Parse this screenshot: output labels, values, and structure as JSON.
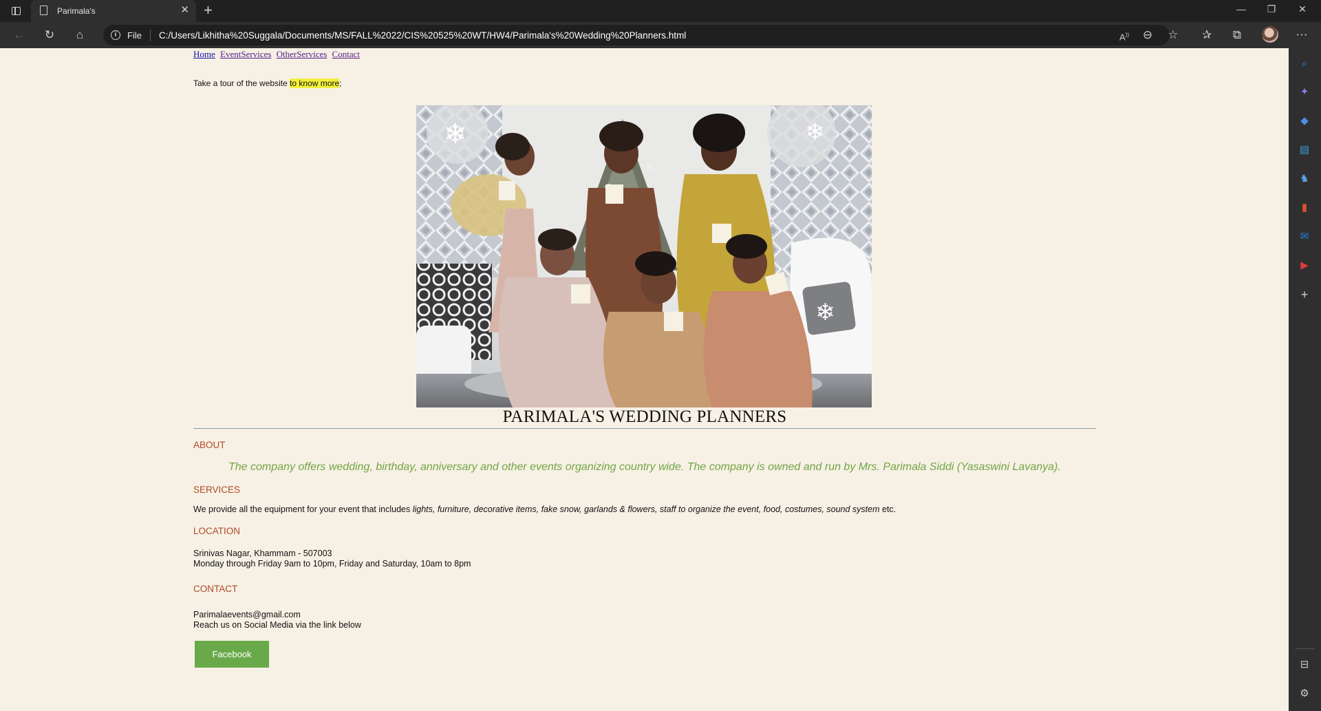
{
  "browser": {
    "tab_title": "Parimala's",
    "url_scheme": "File",
    "url": "C:/Users/Likhitha%20Suggala/Documents/MS/FALL%2022/CIS%20525%20WT/HW4/Parimala's%20Wedding%20Planners.html",
    "icons": [
      "tab-actions-icon",
      "page-icon",
      "close-icon",
      "new-tab-icon",
      "back-icon",
      "refresh-icon",
      "home-icon",
      "info-icon",
      "read-aloud-icon",
      "zoom-out-icon",
      "add-favorite-icon",
      "favorites-icon",
      "collections-icon",
      "profile-avatar",
      "more-icon"
    ],
    "sidebar_icons": [
      "search-icon",
      "copilot-icon",
      "shopping-tag-icon",
      "tools-icon",
      "games-icon",
      "office-icon",
      "outlook-icon",
      "youtube-icon",
      "add-icon",
      "hide-sidebar-icon",
      "settings-icon"
    ]
  },
  "nav": {
    "links": [
      "Home",
      "EventServices",
      "OtherServices",
      "Contact"
    ]
  },
  "intro": {
    "text": "Take a tour of the website ",
    "highlight": "to know more",
    "suffix": ";"
  },
  "hero": {
    "title": "PARIMALA'S WEDDING PLANNERS"
  },
  "about": {
    "heading": "ABOUT",
    "text": "The company offers wedding, birthday, anniversary and other events organizing country wide. The company is owned and run by Mrs. Parimala Siddi (Yasaswini Lavanya)."
  },
  "services": {
    "heading": "SERVICES",
    "prefix": "We provide all the equipment for your event that includes ",
    "items": "lights, furniture, decorative items, fake snow, garlands & flowers, staff to organize the event, food, costumes, sound system",
    "suffix": " etc."
  },
  "location": {
    "heading": "LOCATION",
    "address": "Srinivas Nagar, Khammam - 507003",
    "hours": "Monday through Friday 9am to 10pm, Friday and Saturday, 10am to 8pm"
  },
  "contact": {
    "heading": "CONTACT",
    "email": "Parimalaevents@gmail.com",
    "social_note": "Reach us on Social Media via the link below",
    "button": "Facebook"
  },
  "colors": {
    "page_bg": "#f6f1e4",
    "heading": "#b0482a",
    "about_text": "#74a446",
    "button_bg": "#69a94a",
    "highlight": "#f2f03a"
  }
}
